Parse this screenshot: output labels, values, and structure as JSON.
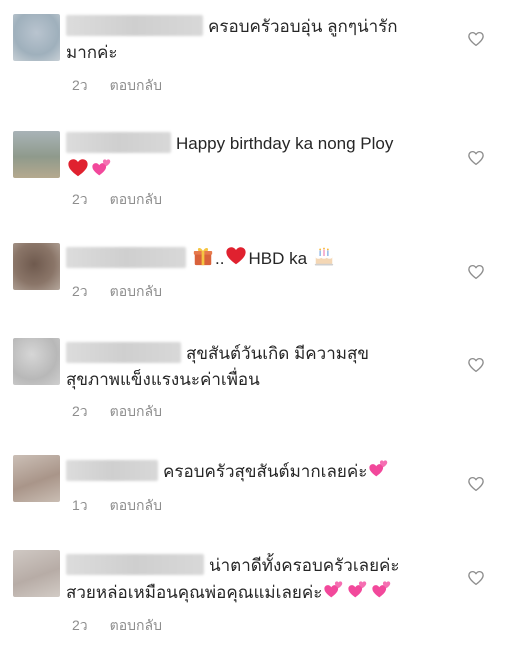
{
  "comments": [
    {
      "text_line1": "ครอบครัวอบอุ่น ลูกๆน่ารัก",
      "text_line2": "มากค่ะ",
      "time": "2ว",
      "reply": "ตอบกลับ"
    },
    {
      "text_line1": "Happy birthday ka nong Ploy",
      "text_line2": "",
      "time": "2ว",
      "reply": "ตอบกลับ"
    },
    {
      "text_pre": "..",
      "text_post": "HBD ka",
      "time": "2ว",
      "reply": "ตอบกลับ"
    },
    {
      "text_line1": "สุขสันต์วันเกิด มีความสุข",
      "text_line2": "สุขภาพแข็งแรงนะค่าเพื่อน",
      "time": "2ว",
      "reply": "ตอบกลับ"
    },
    {
      "text_line1": "ครอบครัวสุขสันต์มากเลยค่ะ",
      "text_line2": "",
      "time": "1ว",
      "reply": "ตอบกลับ"
    },
    {
      "text_line1": "น่าตาดีทั้งครอบครัวเลยค่ะ",
      "text_line2": "สวยหล่อเหมือนคุณพ่อคุณแม่เลยค่ะ",
      "time": "2ว",
      "reply": "ตอบกลับ"
    }
  ],
  "icons": {
    "like": "heart-outline-icon",
    "red_heart": "red-heart-emoji",
    "pink_hearts": "two-hearts-emoji",
    "gift": "gift-emoji",
    "cake": "birthday-cake-emoji"
  },
  "colors": {
    "text": "#262626",
    "meta": "#8e8e8e",
    "heart_outline": "#8e8e8e"
  }
}
